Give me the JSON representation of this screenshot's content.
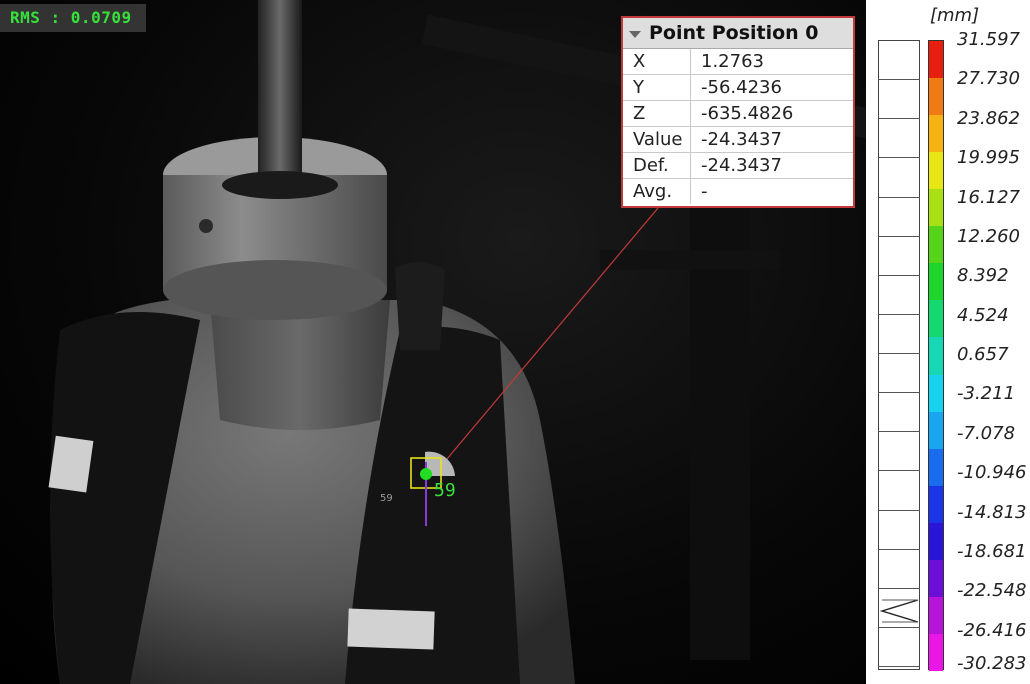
{
  "viewport": {
    "rms_label": "RMS : 0.0709",
    "point_label": "59",
    "small_label": "59",
    "colors": {
      "rms_text": "#38e03c",
      "leader_line": "#c23a3a",
      "target_box": "#e6e21a",
      "point": "#22dd22",
      "needle": "#8a3ad6"
    }
  },
  "info_box": {
    "title": "Point Position 0",
    "rows": [
      {
        "key": "X",
        "value": "1.2763"
      },
      {
        "key": "Y",
        "value": "-56.4236"
      },
      {
        "key": "Z",
        "value": "-635.4826"
      },
      {
        "key": "Value",
        "value": "-24.3437"
      },
      {
        "key": "Def.",
        "value": "-24.3437"
      },
      {
        "key": "Avg.",
        "value": "-"
      }
    ]
  },
  "legend": {
    "unit": "[mm]",
    "labels": [
      "31.597",
      "27.730",
      "23.862",
      "19.995",
      "16.127",
      "12.260",
      "8.392",
      "4.524",
      "0.657",
      "-3.211",
      "-7.078",
      "-10.946",
      "-14.813",
      "-18.681",
      "-22.548",
      "-26.416",
      "-30.283"
    ],
    "colors": [
      "#e81e10",
      "#f27a14",
      "#f5b212",
      "#e9e616",
      "#a9e015",
      "#55d41a",
      "#1ed62b",
      "#16d870",
      "#16d8b4",
      "#16d2ee",
      "#18a6f0",
      "#1a6cee",
      "#1a34e6",
      "#2a14d8",
      "#6a10d6",
      "#b614d8",
      "#ea16e6"
    ],
    "current_value": -24.3437
  }
}
